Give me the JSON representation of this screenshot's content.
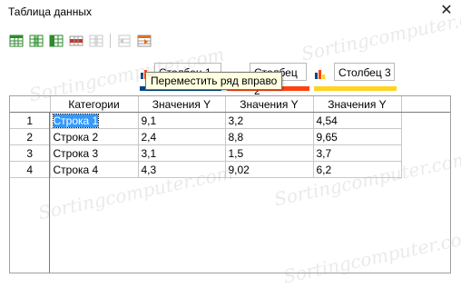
{
  "window": {
    "title": "Таблица данных",
    "close_glyph": "✕"
  },
  "toolbar": {
    "buttons": [
      {
        "name": "insert-row-icon",
        "color": "#2e8b2e"
      },
      {
        "name": "insert-column-icon",
        "color": "#2e8b2e"
      },
      {
        "name": "insert-text-column-icon",
        "color": "#2e8b2e"
      },
      {
        "name": "delete-row-icon",
        "color": "#c0392b"
      },
      {
        "name": "delete-column-icon",
        "color": "#c0c0c0"
      },
      {
        "name": "move-column-left-icon",
        "color": "#c0c0c0"
      },
      {
        "name": "move-row-icon",
        "color": "#e07020"
      }
    ]
  },
  "tooltip": {
    "text": "Переместить ряд вправо"
  },
  "series": [
    {
      "label": "Столбец 1",
      "color": "#004586"
    },
    {
      "label": "Столбец 2",
      "color": "#ff420e"
    },
    {
      "label": "Столбец 3",
      "color": "#ffd320"
    }
  ],
  "table": {
    "headers": [
      "Категории",
      "Значения Y",
      "Значения Y",
      "Значения Y"
    ],
    "rows": [
      {
        "num": "1",
        "cells": [
          "Строка 1",
          "9,1",
          "3,2",
          "4,54"
        ]
      },
      {
        "num": "2",
        "cells": [
          "Строка 2",
          "2,4",
          "8,8",
          "9,65"
        ]
      },
      {
        "num": "3",
        "cells": [
          "Строка 3",
          "3,1",
          "1,5",
          "3,7"
        ]
      },
      {
        "num": "4",
        "cells": [
          "Строка 4",
          "4,3",
          "9,02",
          "6,2"
        ]
      }
    ]
  },
  "watermark": "Sortingcomputer.com"
}
